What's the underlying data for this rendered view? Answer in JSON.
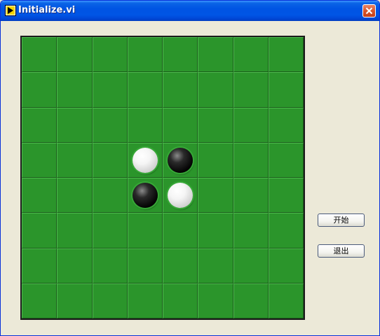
{
  "window": {
    "title": "Initialize.vi",
    "app_icon": "labview-vi-icon",
    "close_icon": "close-icon"
  },
  "board": {
    "rows": 8,
    "cols": 8,
    "colors": {
      "felt": "#2b952b",
      "white_piece": "#ffffff",
      "black_piece": "#000000"
    },
    "pieces": [
      {
        "row": 3,
        "col": 3,
        "color": "white"
      },
      {
        "row": 3,
        "col": 4,
        "color": "black"
      },
      {
        "row": 4,
        "col": 3,
        "color": "black"
      },
      {
        "row": 4,
        "col": 4,
        "color": "white"
      }
    ]
  },
  "controls": {
    "start_label": "开始",
    "exit_label": "退出"
  }
}
